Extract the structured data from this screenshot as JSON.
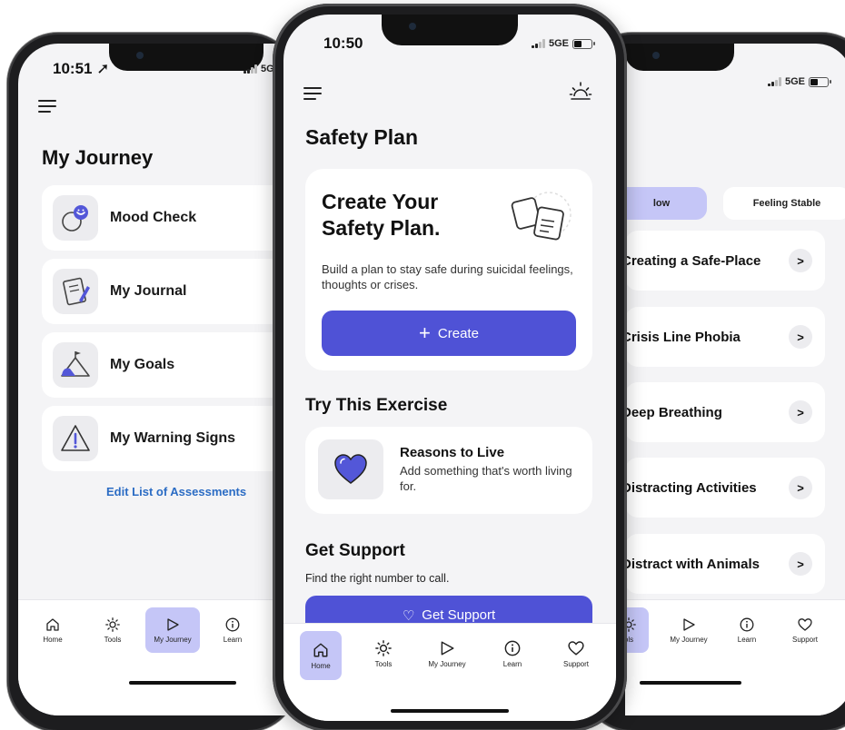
{
  "left_phone": {
    "status_time": "10:51 ➚",
    "network": "5G",
    "title": "My Journey",
    "items": [
      {
        "label": "Mood Check",
        "icon": "mood-check-icon"
      },
      {
        "label": "My Journal",
        "icon": "journal-icon"
      },
      {
        "label": "My Goals",
        "icon": "mountain-flag-icon"
      },
      {
        "label": "My Warning Signs",
        "icon": "warning-triangle-icon"
      }
    ],
    "edit_link": "Edit List of Assessments",
    "tabs": [
      {
        "label": "Home",
        "icon": "home-icon"
      },
      {
        "label": "Tools",
        "icon": "sun-icon"
      },
      {
        "label": "My Journey",
        "icon": "flag-play-icon",
        "active": true
      },
      {
        "label": "Learn",
        "icon": "info-icon"
      }
    ]
  },
  "center_phone": {
    "status_time": "10:50",
    "network": "5GE",
    "title": "Safety Plan",
    "card": {
      "title": "Create Your Safety Plan.",
      "description": "Build a plan to stay safe during suicidal feelings, thoughts or crises.",
      "button_label": "Create",
      "button_icon": "plus-icon"
    },
    "exercise_section": "Try This Exercise",
    "exercise": {
      "title": "Reasons to Live",
      "description": "Add something that's worth living for.",
      "icon": "heart-icon"
    },
    "support_section": "Get Support",
    "support_sub": "Find the right number to call.",
    "support_button": "Get Support",
    "tabs": [
      {
        "label": "Home",
        "icon": "home-icon",
        "active": true
      },
      {
        "label": "Tools",
        "icon": "sun-icon"
      },
      {
        "label": "My Journey",
        "icon": "flag-play-icon"
      },
      {
        "label": "Learn",
        "icon": "info-icon"
      },
      {
        "label": "Support",
        "icon": "heart-outline-icon"
      }
    ]
  },
  "right_phone": {
    "network": "5GE",
    "pills": [
      {
        "label": "low",
        "active": true
      },
      {
        "label": "Feeling Stable",
        "active": false
      }
    ],
    "items": [
      "Creating a Safe-Place",
      "Crisis Line Phobia",
      "Deep Breathing",
      "Distracting Activities",
      "Distract with Animals"
    ],
    "tabs": [
      {
        "label": "ols",
        "icon": "sun-icon",
        "active": true
      },
      {
        "label": "My Journey",
        "icon": "flag-play-icon"
      },
      {
        "label": "Learn",
        "icon": "info-icon"
      },
      {
        "label": "Support",
        "icon": "heart-outline-icon"
      }
    ]
  },
  "colors": {
    "accent": "#4f52d6",
    "accent_soft": "#c5c6f7",
    "link": "#2b6cc4",
    "screen_bg": "#f4f4f6"
  }
}
